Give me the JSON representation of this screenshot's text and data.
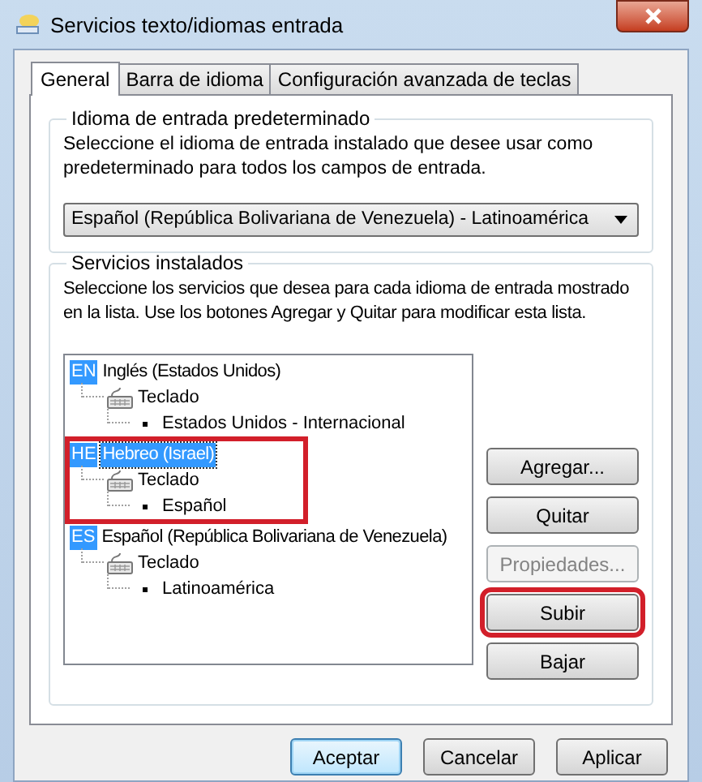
{
  "window": {
    "title": "Servicios texto/idiomas entrada"
  },
  "tabs": [
    {
      "label": "General",
      "selected": true
    },
    {
      "label": "Barra de idioma",
      "selected": false
    },
    {
      "label": "Configuración avanzada de teclas",
      "selected": false
    }
  ],
  "default_language": {
    "title": "Idioma de entrada predeterminado",
    "description": "Seleccione el idioma de entrada instalado que desee usar como predeterminado para todos los campos de entrada.",
    "dropdown": {
      "value": "Español (República Bolivariana de Venezuela) - Latinoamérica"
    }
  },
  "installed_services": {
    "title": "Servicios instalados",
    "description": "Seleccione los servicios que desea para cada idioma de entrada mostrado en la lista. Use los botones Agregar y Quitar para modificar esta lista.",
    "tree": [
      {
        "kind": "language",
        "code": "EN",
        "label": "Inglés (Estados Unidos)",
        "selected": false,
        "highlighted": false,
        "children": [
          {
            "kind": "category",
            "label": "Teclado",
            "children": [
              {
                "kind": "layout",
                "label": "Estados Unidos - Internacional"
              }
            ]
          }
        ]
      },
      {
        "kind": "language",
        "code": "HE",
        "label": "Hebreo (Israel)",
        "selected": true,
        "highlighted": true,
        "children": [
          {
            "kind": "category",
            "label": "Teclado",
            "children": [
              {
                "kind": "layout",
                "label": "Español"
              }
            ]
          }
        ]
      },
      {
        "kind": "language",
        "code": "ES",
        "label": "Español (República Bolivariana de Venezuela)",
        "selected": false,
        "highlighted": false,
        "children": [
          {
            "kind": "category",
            "label": "Teclado",
            "children": [
              {
                "kind": "layout",
                "label": "Latinoamérica"
              }
            ]
          }
        ]
      }
    ],
    "buttons": [
      {
        "label": "Agregar...",
        "disabled": false,
        "highlighted": false
      },
      {
        "label": "Quitar",
        "disabled": false,
        "highlighted": false
      },
      {
        "label": "Propiedades...",
        "disabled": true,
        "highlighted": false
      },
      {
        "label": "Subir",
        "disabled": false,
        "highlighted": true
      },
      {
        "label": "Bajar",
        "disabled": false,
        "highlighted": false
      }
    ]
  },
  "footer_buttons": [
    {
      "label": "Aceptar",
      "default": true
    },
    {
      "label": "Cancelar",
      "default": false
    },
    {
      "label": "Aplicar",
      "default": false
    }
  ]
}
